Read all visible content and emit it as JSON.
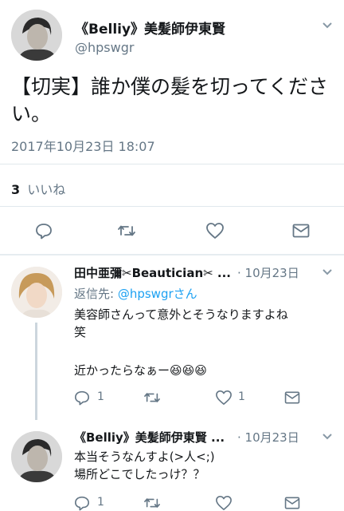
{
  "main_tweet": {
    "author_name": "《Belliy》美髪師伊東賢",
    "handle": "@hpswgr",
    "text": "【切実】誰か僕の髪を切ってください。",
    "timestamp": "2017年10月23日 18:07",
    "likes_count": "3",
    "likes_label": "いいね",
    "icons": [
      "avatar",
      "chevron-down-icon",
      "reply-icon",
      "retweet-icon",
      "like-icon",
      "dm-icon"
    ]
  },
  "replies": [
    {
      "author_name": "田中亜彌✂Beautician✂ ...",
      "date": "10月23日",
      "reply_to_prefix": "返信先: ",
      "reply_to_handle": "@hpswgrさん",
      "line1": "美容師さんって意外とそうなりますよね",
      "line2": "笑",
      "line3": "近かったらなぁー",
      "emoji": "😆😆😆",
      "reply_count": "1",
      "retweet_count": "",
      "like_count": "1"
    },
    {
      "author_name": "《Belliy》美髪師伊東賢 ...",
      "date": "10月23日",
      "line1": "本当そうなんすよ(>人<;)",
      "line2": "場所どこでしたっけ？？",
      "reply_count": "1"
    }
  ],
  "colors": {
    "accent": "#1da1f2",
    "muted": "#657786",
    "divider": "#e1e8ed",
    "thread_line": "#ccd6dd"
  }
}
